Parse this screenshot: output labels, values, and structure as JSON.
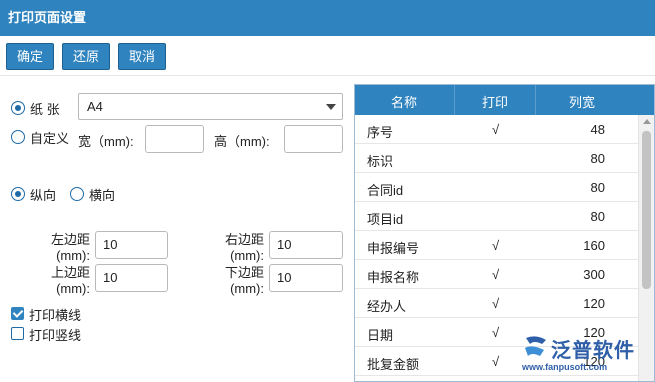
{
  "window": {
    "title": "打印页面设置"
  },
  "toolbar": {
    "confirm_label": "确定",
    "restore_label": "还原",
    "cancel_label": "取消"
  },
  "paper": {
    "paper_label": "纸 张",
    "paper_selected": true,
    "paper_value": "A4",
    "custom_label": "自定义",
    "custom_selected": false,
    "width_label": "宽（mm):",
    "width_value": "",
    "height_label": "高（mm):",
    "height_value": ""
  },
  "orientation": {
    "portrait_label": "纵向",
    "portrait_selected": true,
    "landscape_label": "横向",
    "landscape_selected": false
  },
  "margins": {
    "left_label": "左边距\n(mm):",
    "left_value": "10",
    "right_label": "右边距\n(mm):",
    "right_value": "10",
    "top_label": "上边距\n(mm):",
    "top_value": "10",
    "bottom_label": "下边距\n(mm):",
    "bottom_value": "10"
  },
  "options": {
    "h_lines_label": "打印横线",
    "h_lines_checked": true,
    "v_lines_label": "打印竖线",
    "v_lines_checked": false
  },
  "grid": {
    "headers": {
      "name": "名称",
      "print": "打印",
      "width": "列宽"
    },
    "rows": [
      {
        "name": "序号",
        "print": "√",
        "width": "48"
      },
      {
        "name": "标识",
        "print": "",
        "width": "80"
      },
      {
        "name": "合同id",
        "print": "",
        "width": "80"
      },
      {
        "name": "项目id",
        "print": "",
        "width": "80"
      },
      {
        "name": "申报编号",
        "print": "√",
        "width": "160"
      },
      {
        "name": "申报名称",
        "print": "√",
        "width": "300"
      },
      {
        "name": "经办人",
        "print": "√",
        "width": "120"
      },
      {
        "name": "日期",
        "print": "√",
        "width": "120"
      },
      {
        "name": "批复金额",
        "print": "√",
        "width": "120"
      }
    ]
  },
  "watermark": {
    "brand": "泛普软件",
    "url": "www.fanpusoft.com"
  },
  "colors": {
    "accent": "#2f83be",
    "header_text": "#ffffff",
    "watermark": "#2f5fa8"
  }
}
